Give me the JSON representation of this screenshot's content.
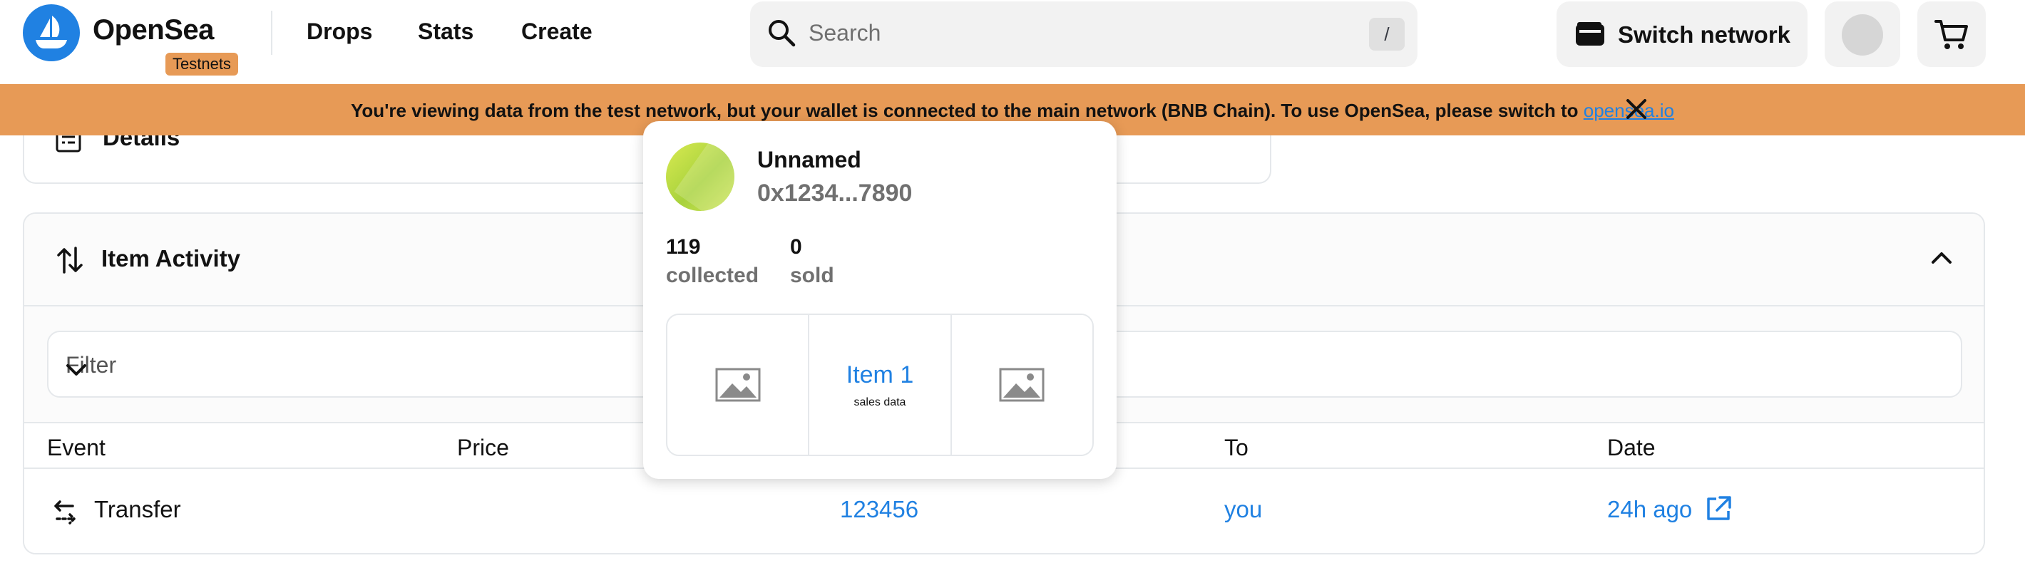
{
  "header": {
    "brand": "OpenSea",
    "badge": "Testnets",
    "nav": [
      "Drops",
      "Stats",
      "Create"
    ],
    "search": {
      "placeholder": "Search",
      "shortcut": "/"
    },
    "switch_network": "Switch network"
  },
  "banner": {
    "text": "You're viewing data from the test network, but your wallet is connected to the main network (BNB Chain). To use OpenSea, please switch to ",
    "link": "opensea.io"
  },
  "details": {
    "title": "Details"
  },
  "activity": {
    "title": "Item Activity",
    "filter_placeholder": "Filter",
    "columns": {
      "event": "Event",
      "price": "Price",
      "to": "To",
      "date": "Date"
    },
    "row": {
      "event": "Transfer",
      "from": "123456",
      "to": "you",
      "date": "24h ago"
    }
  },
  "popover": {
    "name": "Unnamed",
    "address": "0x1234...7890",
    "stats": [
      {
        "value": "119",
        "label": "collected"
      },
      {
        "value": "0",
        "label": "sold"
      }
    ],
    "tiles": {
      "middle_title": "Item 1",
      "middle_sub": "sales data"
    }
  },
  "colors": {
    "brand_blue": "#2081e2",
    "banner_orange": "#e79a56"
  }
}
